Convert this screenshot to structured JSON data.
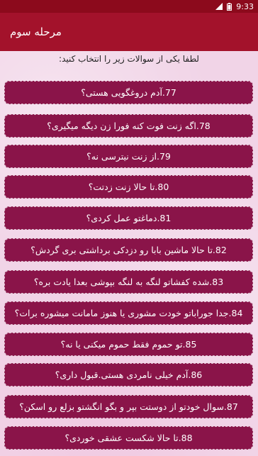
{
  "status_bar": {
    "time": "9:33",
    "icons": [
      "signal-icon",
      "battery-icon"
    ]
  },
  "app_bar": {
    "title": "مرحله سوم"
  },
  "instruction": "لطفا یکی از سوالات زیر را انتخاب کنید:",
  "colors": {
    "status_bar": "#8c0a1c",
    "app_bar": "#a3122b",
    "button": "#8a1449",
    "background": "#f3d9ea"
  },
  "questions": [
    {
      "label": "77.آدم دروغگویی هستی؟"
    },
    {
      "label": "78.اگه زنت فوت کنه فورا زن دیگه میگیری؟"
    },
    {
      "label": "79.از زنت نیترسی نه؟"
    },
    {
      "label": "80.تا حالا زنت زدتت؟"
    },
    {
      "label": "81.دماغتو عمل کردی؟"
    },
    {
      "label": "82.تا حالا ماشین بابا رو دزدکی برداشتی بری گردش؟"
    },
    {
      "label": "83.شده کفشاتو لنگه به لنگه بپوشی بعدا یادت بره؟"
    },
    {
      "label": "84.جدا جوراباتو خودت مشوری یا هنوز مامانت میشوره برات؟"
    },
    {
      "label": "85.تو حموم فقط حموم میکنی یا نه؟"
    },
    {
      "label": "86.آدم خیلی نامردی هستی.قبول داری؟"
    },
    {
      "label": "87.سوال خودتو از دوستت بپر و بگو انگشتو بزلع رو اسکن؟"
    },
    {
      "label": "88.تا حالا شکست عشقی خوردی؟"
    }
  ]
}
